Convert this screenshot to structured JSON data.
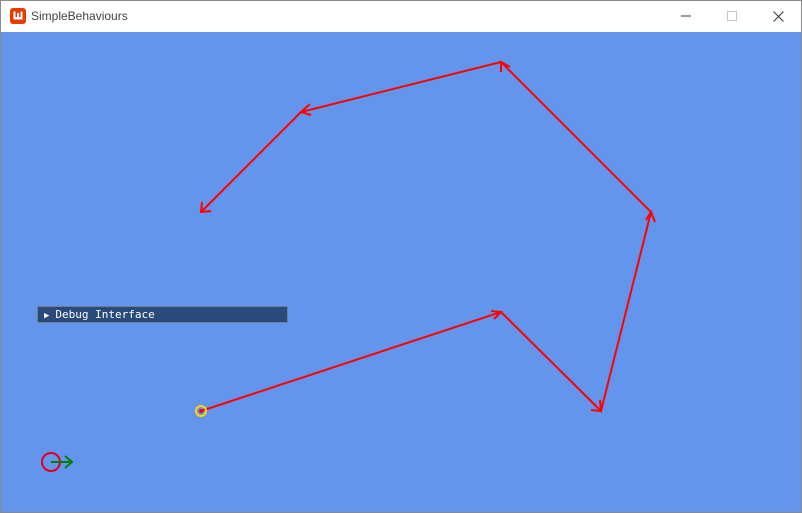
{
  "window": {
    "title": "SimpleBehaviours",
    "icon": "monogame-logo-icon",
    "background_color": "#6495ed"
  },
  "controls": {
    "minimize": "minimize-icon",
    "maximize": "maximize-icon",
    "close": "close-icon"
  },
  "debug_panel": {
    "label": "Debug Interface",
    "expanded": false
  },
  "scene": {
    "path_color": "#ff0000",
    "agent_color": "#ffd700",
    "origin_circle_color": "#ff0000",
    "origin_arrow_color": "#008000"
  }
}
